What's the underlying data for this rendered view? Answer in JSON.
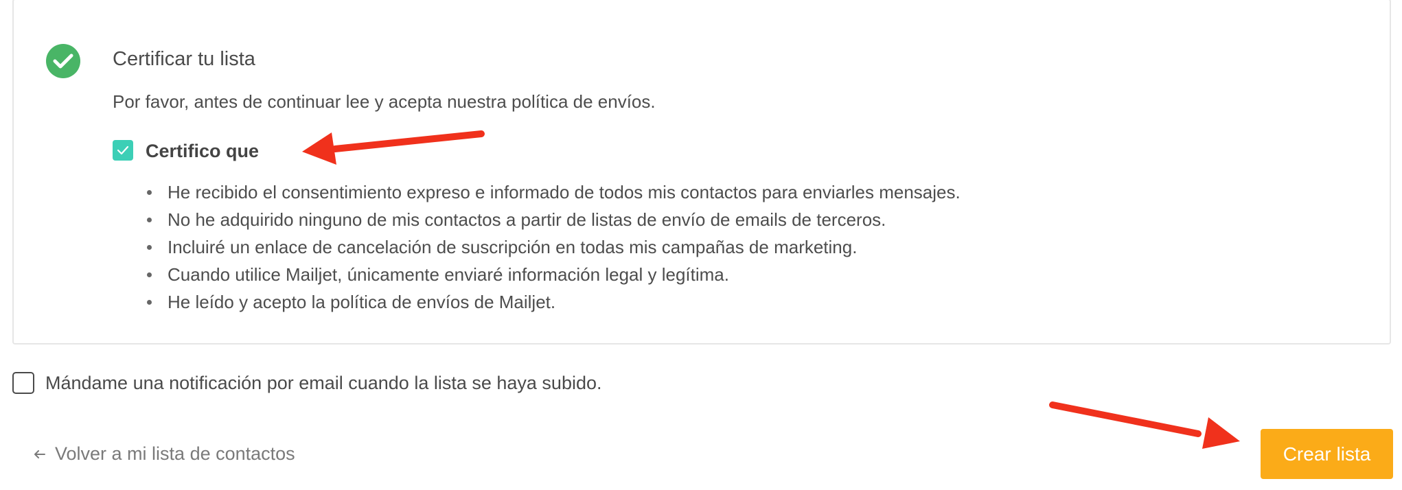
{
  "certification": {
    "title": "Certificar tu lista",
    "intro": "Por favor, antes de continuar lee y acepta nuestra política de envíos.",
    "checkbox_label": "Certifico que",
    "checked": true,
    "status_icon": "check-circle-icon",
    "terms": [
      "He recibido el consentimiento expreso e informado de todos mis contactos para enviarles mensajes.",
      "No he adquirido ninguno de mis contactos a partir de listas de envío de emails de terceros.",
      "Incluiré un enlace de cancelación de suscripción en todas mis campañas de marketing.",
      "Cuando utilice Mailjet, únicamente enviaré información legal y legítima.",
      "He leído y acepto la política de envíos de Mailjet."
    ]
  },
  "notification": {
    "label": "Mándame una notificación por email cuando la lista se haya subido.",
    "checked": false
  },
  "footer": {
    "back_label": "Volver a mi lista de contactos",
    "back_icon": "arrow-left-icon",
    "create_label": "Crear lista"
  },
  "colors": {
    "accent_button": "#fbab18",
    "checkbox_checked": "#3ccfb6",
    "success_icon": "#49b566",
    "annotation_arrow": "#f0311c"
  }
}
